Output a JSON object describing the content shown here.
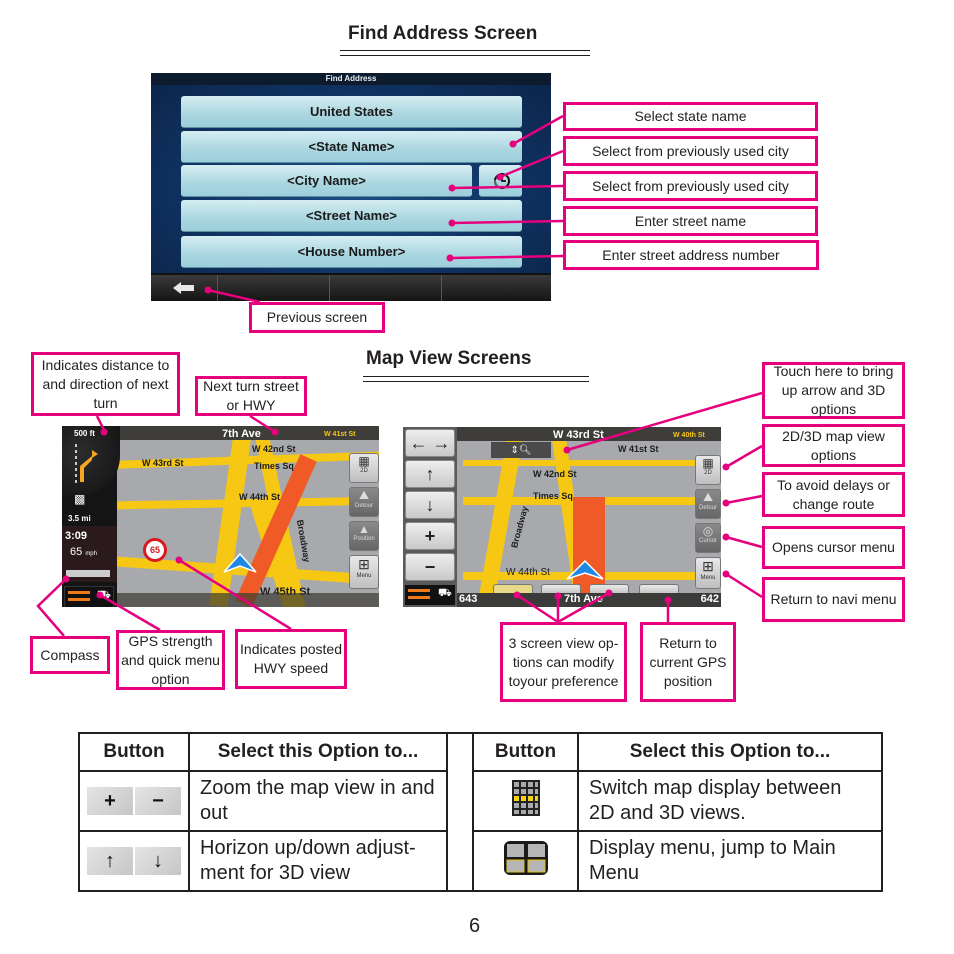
{
  "find_address": {
    "section_title": "Find Address Screen",
    "screen_header": "Find Address",
    "fields": [
      {
        "label": "United States"
      },
      {
        "label": "<State Name>"
      },
      {
        "label": "<City Name>"
      },
      {
        "label": "<Street Name>"
      },
      {
        "label": "<House Number>"
      }
    ],
    "history_icon": "history-clock-icon",
    "back_icon": "back-arrow-icon",
    "callouts": {
      "state": "Select state name",
      "history": "Select from previously used city",
      "city": "Select from previously used city",
      "street": "Enter street name",
      "house": "Enter street address number",
      "previous": "Previous screen"
    }
  },
  "map_view": {
    "section_title": "Map View Screens",
    "left_map": {
      "next_street": "7th Ave",
      "distance": "500 ft",
      "remaining": "3.5 mi",
      "time": "3:09",
      "speed": "65",
      "speed_unit": "mph",
      "speed_limit": "65",
      "streets": [
        "W 43rd St",
        "W 42nd St",
        "W 41st St",
        "Times Sq",
        "W 44th St",
        "Broadway",
        "W 45th St"
      ],
      "side_buttons": [
        "2D",
        "Detour",
        "Position",
        "Menu"
      ]
    },
    "right_map": {
      "next_street": "W 43rd St",
      "bottom_street": "7th Ave",
      "bottom_left_num": "643",
      "bottom_right_num": "642",
      "streets": [
        "W 40th St",
        "W 41st St",
        "W 42nd St",
        "Times Sq",
        "Broadway",
        "W 44th St"
      ],
      "side_buttons": [
        "2D",
        "Detour",
        "Cursor",
        "Menu"
      ],
      "nav_buttons": [
        "← →",
        "↑",
        "↓",
        "+",
        "−"
      ]
    },
    "callouts": {
      "distance": "Indicates distance to and direction of next turn",
      "next_turn": "Next turn street or HWY",
      "compass": "Compass",
      "gps": "GPS strength and quick menu option",
      "speed": "Indicates posted HWY speed",
      "arrow_3d": "Touch here to bring up arrow and 3D options",
      "view_2d3d": "2D/3D map view options",
      "detour": "To avoid delays or change route",
      "cursor": "Opens cursor menu",
      "navi_menu": "Return to navi menu",
      "screen_view": "3 screen view op-tions can modify toyour preference",
      "gps_position": "Return to current GPS position"
    }
  },
  "options_table": {
    "headers": [
      "Button",
      "Select this Option to...",
      "Button",
      "Select this Option to..."
    ],
    "rows": [
      {
        "left_icon": "zoom-plus-minus-icon",
        "left_glyphs": [
          "+",
          "−"
        ],
        "left_text": "Zoom the map view in and out",
        "right_icon": "grid-2d3d-icon",
        "right_text": "Switch map display between 2D and 3D views."
      },
      {
        "left_icon": "horizon-up-down-icon",
        "left_glyphs": [
          "↑",
          "↓"
        ],
        "left_text": "Horizon up/down adjust-ment for 3D view",
        "right_icon": "menu-icon",
        "right_text": "Display menu, jump to Main Menu"
      }
    ]
  },
  "page_number": "6",
  "colors": {
    "callout_border": "#e6007e",
    "street": "#f6c813",
    "route": "#ef5a26",
    "screen_blue": "#1c4f85"
  }
}
